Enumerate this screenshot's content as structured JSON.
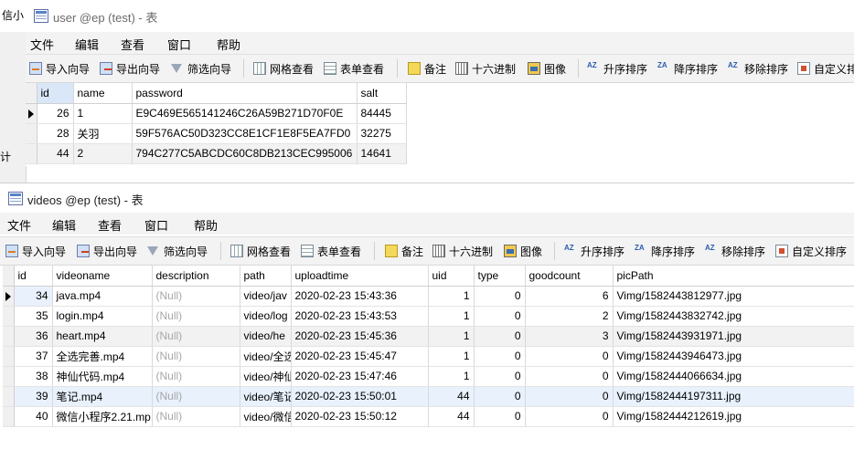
{
  "bg_window": {
    "title_fragment": "信小",
    "side_fragment": "计"
  },
  "user_window": {
    "title": "user @ep (test) - 表",
    "menu": [
      "文件",
      "编辑",
      "查看",
      "窗口",
      "帮助"
    ],
    "toolbar": [
      "导入向导",
      "导出向导",
      "筛选向导",
      "网格查看",
      "表单查看",
      "备注",
      "十六进制",
      "图像",
      "升序排序",
      "降序排序",
      "移除排序",
      "自定义排"
    ],
    "columns": [
      "id",
      "name",
      "password",
      "salt"
    ],
    "rows": [
      {
        "id": "26",
        "name": "1",
        "password": "E9C469E565141246C26A59B271D70F0E",
        "salt": "84445"
      },
      {
        "id": "28",
        "name": "关羽",
        "password": "59F576AC50D323CC8E1CF1E8F5EA7FD0",
        "salt": "32275"
      },
      {
        "id": "44",
        "name": "2",
        "password": "794C277C5ABCDC60C8DB213CEC995006",
        "salt": "14641"
      }
    ]
  },
  "videos_window": {
    "title": "videos @ep (test) - 表",
    "menu": [
      "文件",
      "编辑",
      "查看",
      "窗口",
      "帮助"
    ],
    "toolbar": [
      "导入向导",
      "导出向导",
      "筛选向导",
      "网格查看",
      "表单查看",
      "备注",
      "十六进制",
      "图像",
      "升序排序",
      "降序排序",
      "移除排序",
      "自定义排序"
    ],
    "columns": [
      "id",
      "videoname",
      "description",
      "path",
      "uploadtime",
      "uid",
      "type",
      "goodcount",
      "picPath"
    ],
    "rows": [
      {
        "id": "34",
        "videoname": "java.mp4",
        "description": "(Null)",
        "path": "video/jav",
        "uploadtime": "2020-02-23 15:43:36",
        "uid": "1",
        "type": "0",
        "goodcount": "6",
        "picPath": "Vimg/1582443812977.jpg"
      },
      {
        "id": "35",
        "videoname": "login.mp4",
        "description": "(Null)",
        "path": "video/log",
        "uploadtime": "2020-02-23 15:43:53",
        "uid": "1",
        "type": "0",
        "goodcount": "2",
        "picPath": "Vimg/1582443832742.jpg"
      },
      {
        "id": "36",
        "videoname": "heart.mp4",
        "description": "(Null)",
        "path": "video/he",
        "uploadtime": "2020-02-23 15:45:36",
        "uid": "1",
        "type": "0",
        "goodcount": "3",
        "picPath": "Vimg/1582443931971.jpg"
      },
      {
        "id": "37",
        "videoname": "全选完善.mp4",
        "description": "(Null)",
        "path": "video/全选",
        "uploadtime": "2020-02-23 15:45:47",
        "uid": "1",
        "type": "0",
        "goodcount": "0",
        "picPath": "Vimg/1582443946473.jpg"
      },
      {
        "id": "38",
        "videoname": "神仙代码.mp4",
        "description": "(Null)",
        "path": "video/神仙",
        "uploadtime": "2020-02-23 15:47:46",
        "uid": "1",
        "type": "0",
        "goodcount": "0",
        "picPath": "Vimg/1582444066634.jpg"
      },
      {
        "id": "39",
        "videoname": "笔记.mp4",
        "description": "(Null)",
        "path": "video/笔记",
        "uploadtime": "2020-02-23 15:50:01",
        "uid": "44",
        "type": "0",
        "goodcount": "0",
        "picPath": "Vimg/1582444197311.jpg"
      },
      {
        "id": "40",
        "videoname": "微信小程序2.21.mp",
        "description": "(Null)",
        "path": "video/微信",
        "uploadtime": "2020-02-23 15:50:12",
        "uid": "44",
        "type": "0",
        "goodcount": "0",
        "picPath": "Vimg/1582444212619.jpg"
      }
    ]
  }
}
